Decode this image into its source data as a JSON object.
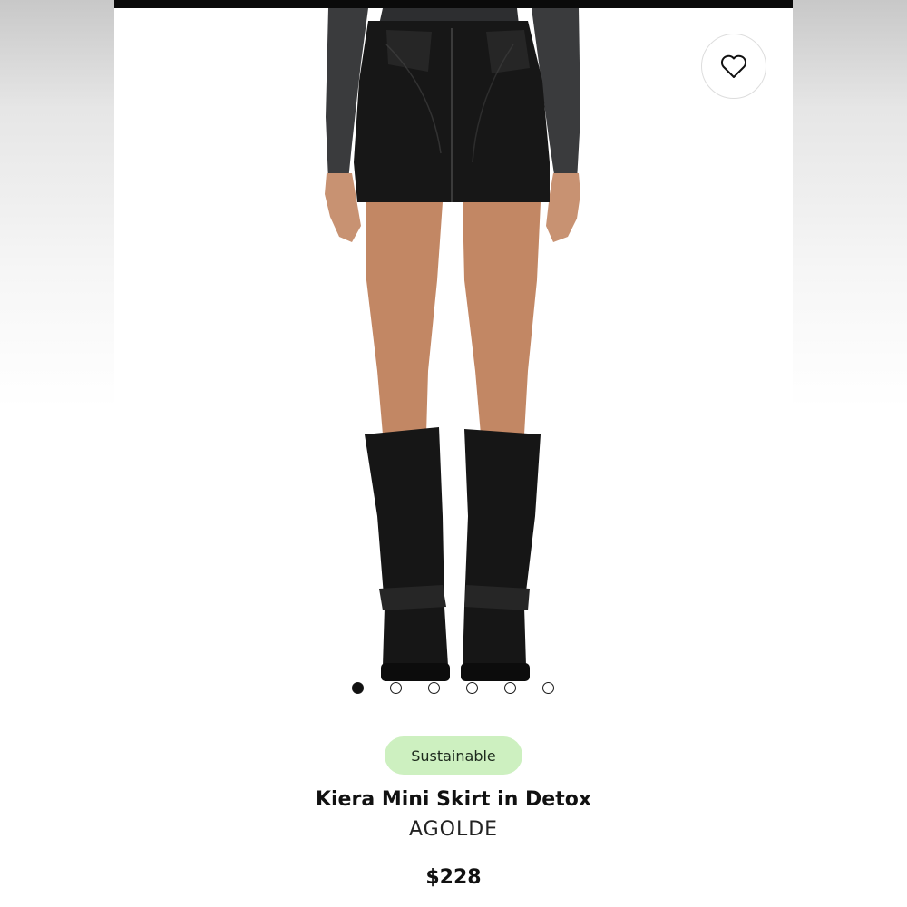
{
  "product": {
    "badge": "Sustainable",
    "name": "Kiera Mini Skirt in Detox",
    "brand": "AGOLDE",
    "price": "$228"
  },
  "wishlist": {
    "icon": "heart-outline-icon"
  },
  "gallery": {
    "image_count": 6,
    "active_index": 0
  },
  "colors": {
    "badge_background": "#cdf0c0",
    "text": "#111111"
  }
}
